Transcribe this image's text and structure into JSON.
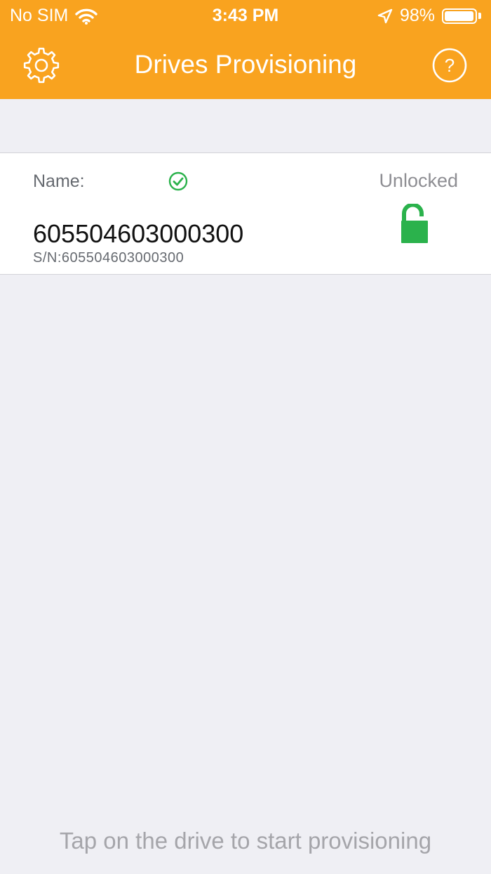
{
  "status_bar": {
    "carrier": "No SIM",
    "time": "3:43 PM",
    "battery_percent": "98%",
    "battery_level": 0.98
  },
  "nav": {
    "title": "Drives Provisioning",
    "left_icon": "gear-icon",
    "right_icon": "help-icon"
  },
  "drives": [
    {
      "name_label": "Name:",
      "name": "605504603000300",
      "serial": "S/N:605504603000300",
      "lock_status": "Unlocked",
      "verified": true
    }
  ],
  "footer": {
    "hint": "Tap on the drive to start provisioning"
  },
  "colors": {
    "brand": "#f9a31f",
    "background": "#efeff4",
    "success": "#2bb24c"
  }
}
